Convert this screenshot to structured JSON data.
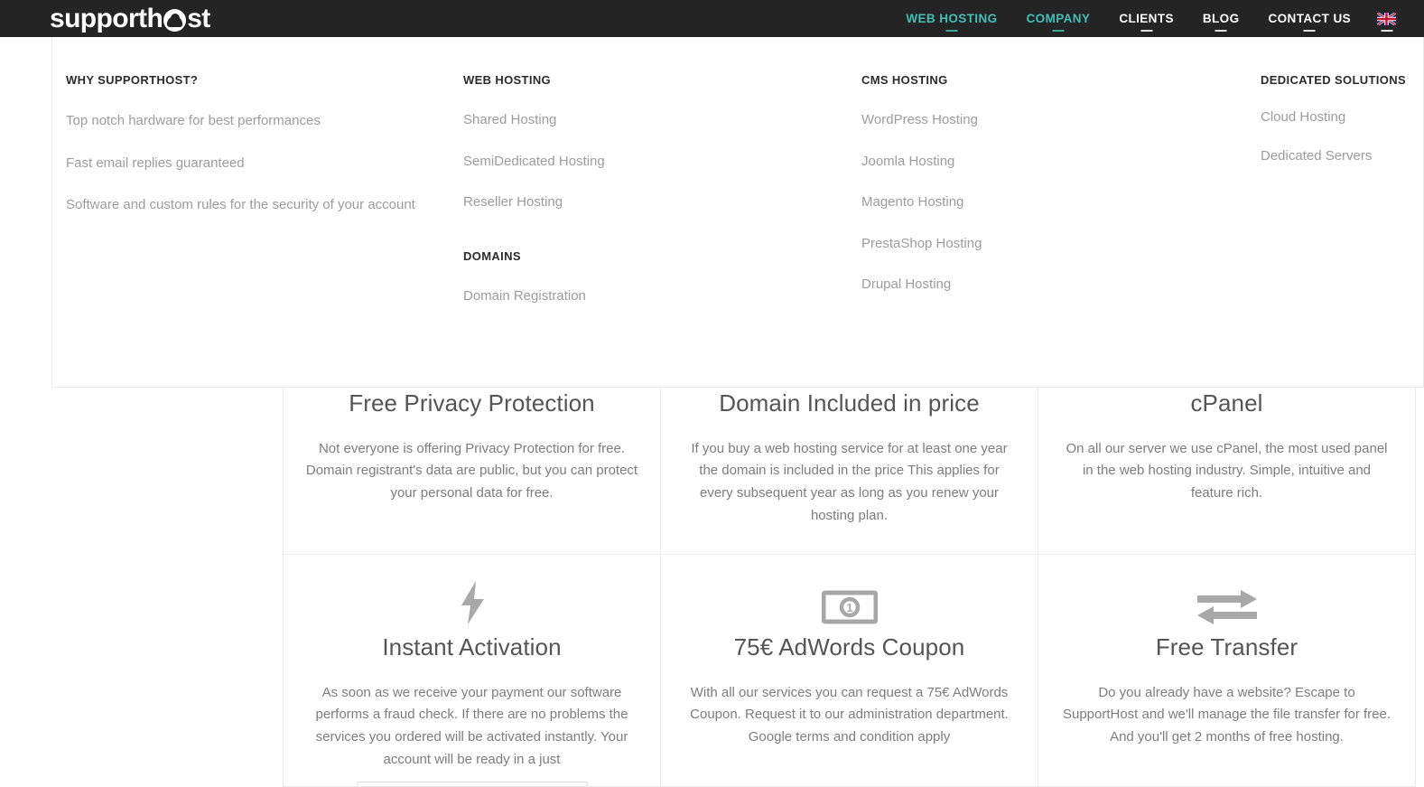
{
  "site": {
    "logo_pre": "supporth",
    "logo_post": "st",
    "logo_mark_icon": "cloud-circle-icon"
  },
  "nav": {
    "items": [
      {
        "label": "WEB HOSTING",
        "accent": true,
        "has_caret": true
      },
      {
        "label": "COMPANY",
        "accent": true,
        "has_caret": true
      },
      {
        "label": "CLIENTS",
        "accent": false,
        "has_caret": true
      },
      {
        "label": "BLOG",
        "accent": false,
        "has_caret": true
      },
      {
        "label": "CONTACT US",
        "accent": false,
        "has_caret": true
      }
    ],
    "flag": {
      "icon": "uk-flag-icon",
      "label": "English"
    }
  },
  "colors": {
    "topbar_bg": "#242424",
    "accent": "#3fbfb8",
    "nav_text": "#ffffff",
    "dropdown_bg": "#ffffff",
    "dropdown_border": "#e9e9e9",
    "link_text": "#9c9c9c",
    "heading_text": "#2b2b2b",
    "card_title": "#555555",
    "card_body": "#7d7d7d",
    "card_border": "#ececec",
    "icon_gray": "#b0b0b0"
  },
  "mega_menu": {
    "columns": [
      {
        "title": "WHY SUPPORTHOST?",
        "links": [
          "Top notch hardware for best performances",
          "Fast email replies guaranteed",
          "Software and custom rules for the security of your account"
        ]
      },
      {
        "title": "WEB HOSTING",
        "links": [
          "Shared Hosting",
          "SemiDedicated Hosting",
          "Reseller Hosting"
        ],
        "subtitle": "DOMAINS",
        "sublinks": [
          "Domain Registration"
        ]
      },
      {
        "title": "CMS HOSTING",
        "links": [
          "WordPress Hosting",
          "Joomla Hosting",
          "Magento Hosting",
          "PrestaShop Hosting",
          "Drupal Hosting"
        ]
      },
      {
        "title": "DEDICATED SOLUTIONS",
        "links": [
          "Cloud Hosting",
          "Dedicated Servers"
        ]
      }
    ]
  },
  "features": [
    {
      "title": "Free Privacy Protection",
      "body": "Not everyone is offering Privacy Protection for free. Domain registrant's data are public, but you can protect your personal data for free.",
      "icon": "shield-icon"
    },
    {
      "title": "Domain Included in price",
      "body": "If you buy a web hosting service for at least one year the domain is included in the price This applies for every subsequent year as long as you renew your hosting plan.",
      "icon": "globe-icon"
    },
    {
      "title": "cPanel",
      "body": "On all our server we use cPanel, the most used panel in the web hosting industry. Simple, intuitive and feature rich.",
      "icon": "cpanel-icon"
    },
    {
      "title": "Instant Activation",
      "body": "As soon as we receive your payment our software performs a fraud check. If there are no problems the services you ordered will be activated instantly. Your account will be ready in a just",
      "icon": "lightning-bolt-icon"
    },
    {
      "title": "75€ AdWords Coupon",
      "body": "With all our services you can request a 75€ AdWords Coupon. Request it to our administration department. Google terms and condition apply",
      "icon": "banknote-icon"
    },
    {
      "title": "Free Transfer",
      "body": "Do you already have a website? Escape to SupportHost and we'll manage the file transfer for free. And you'll get 2 months of free hosting.",
      "icon": "transfer-arrows-icon"
    }
  ]
}
